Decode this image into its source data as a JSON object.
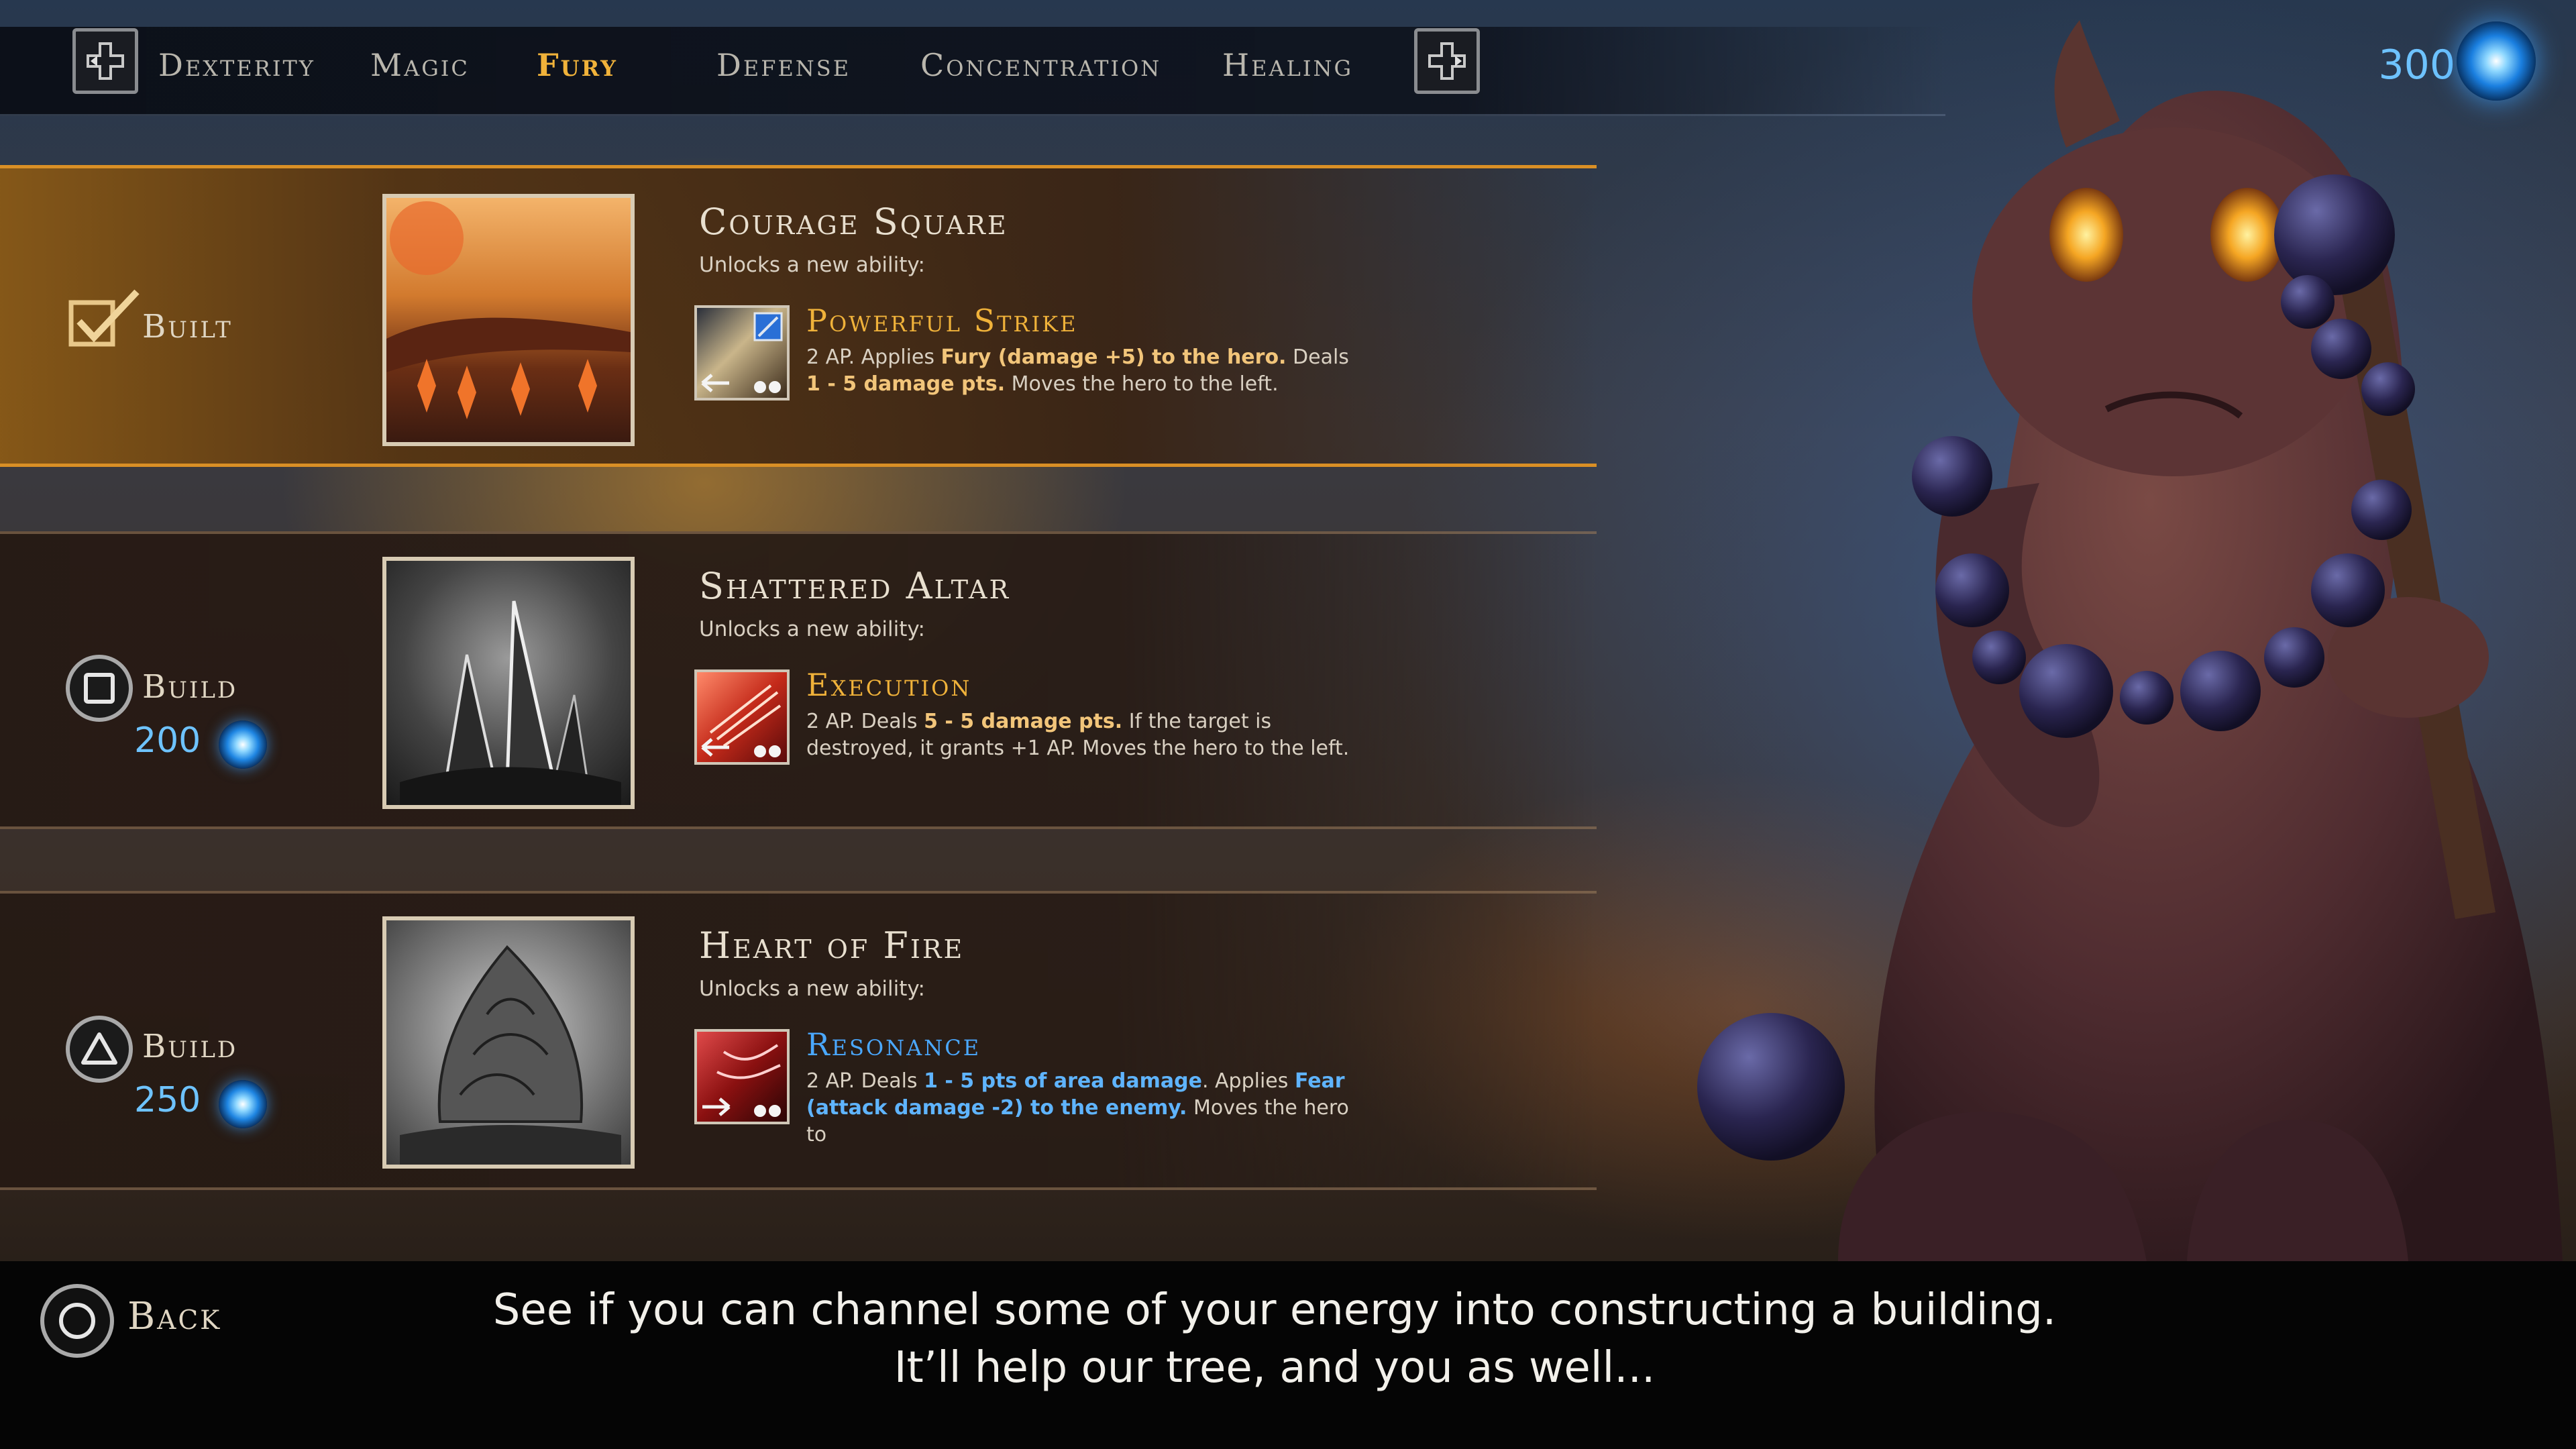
{
  "nav": {
    "tabs": [
      {
        "label": "Dexterity"
      },
      {
        "label": "Magic"
      },
      {
        "label": "Fury"
      },
      {
        "label": "Defense"
      },
      {
        "label": "Concentration"
      },
      {
        "label": "Healing"
      }
    ],
    "active_tab": "Fury",
    "currency": "300"
  },
  "buildings": [
    {
      "status": "Built",
      "cost": "",
      "title": "Courage Square",
      "unlocks": "Unlocks a new ability:",
      "ability": {
        "name": "Powerful Strike",
        "desc_a": "2 AP. Applies ",
        "desc_b": "Fury (damage +5) to the hero.",
        "desc_c": " Deals ",
        "desc_d": "1 - 5 damage pts.",
        "desc_e": " Moves the hero to the left."
      }
    },
    {
      "status": "Build",
      "cost": "200",
      "title": "Shattered Altar",
      "unlocks": "Unlocks a new ability:",
      "ability": {
        "name": "Execution",
        "desc_a": "2 AP. Deals ",
        "desc_b": "5 - 5 damage pts.",
        "desc_c": " If the target is destroyed, it grants +1 AP. Moves the hero to the left."
      }
    },
    {
      "status": "Build",
      "cost": "250",
      "title": "Heart of Fire",
      "unlocks": "Unlocks a new ability:",
      "ability": {
        "name": "Resonance",
        "desc_a": "2 AP. Deals ",
        "desc_b": "1 - 5 pts of area damage",
        "desc_c": ". Applies ",
        "desc_d": "Fear (attack damage -2) to the enemy.",
        "desc_e": "  Moves the hero to"
      }
    }
  ],
  "footer": {
    "back_label": "Back",
    "subtitle_line1": "See if you can channel some of your energy into constructing a building.",
    "subtitle_line2": "It’ll help our tree, and you as well..."
  },
  "colors": {
    "accent_gold": "#f0b23a",
    "currency_blue": "#6ec3ff",
    "built_border": "#d98f25"
  },
  "icons": {
    "tab_prev": "dpad-left-icon",
    "tab_next": "dpad-right-icon",
    "currency": "blue-orb-icon",
    "built": "checkmark-icon",
    "build_square": "square-button-icon",
    "build_triangle": "triangle-button-icon",
    "back": "circle-button-icon"
  }
}
